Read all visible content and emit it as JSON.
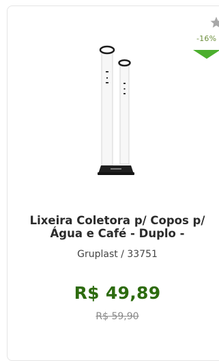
{
  "product": {
    "title": "Lixeira Coletora p/ Copos p/ Água e Café - Duplo -",
    "brand_code": "Gruplast / 33751",
    "price": "R$ 49,89",
    "old_price": "R$ 59,90",
    "discount": "-16%",
    "favorite_icon": "star-icon",
    "colors": {
      "price": "#2d6b0f",
      "discount_arrow": "#4caf2e",
      "star": "#a8a8a8"
    }
  }
}
